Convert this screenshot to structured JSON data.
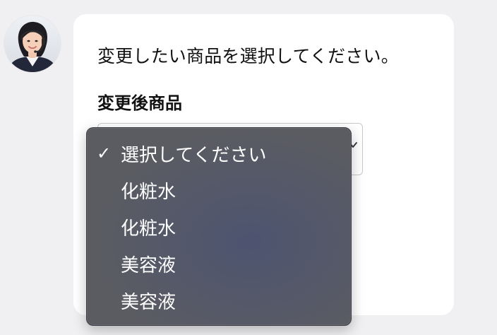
{
  "message": {
    "text": "変更したい商品を選択してください。"
  },
  "field": {
    "label": "変更後商品"
  },
  "select": {
    "selected": "選択してください"
  },
  "dropdown": {
    "options": [
      {
        "label": "選択してください",
        "selected": true
      },
      {
        "label": "化粧水",
        "selected": false
      },
      {
        "label": "化粧水",
        "selected": false
      },
      {
        "label": "美容液",
        "selected": false
      },
      {
        "label": "美容液",
        "selected": false
      }
    ]
  },
  "icons": {
    "check": "✓",
    "avatar": "support-agent-avatar",
    "chevron": "chevron-down-icon"
  },
  "colors": {
    "background": "#f0f0f2",
    "card": "#ffffff",
    "menu": "#5b5c62",
    "menu_text": "#ffffff",
    "text": "#111111"
  }
}
